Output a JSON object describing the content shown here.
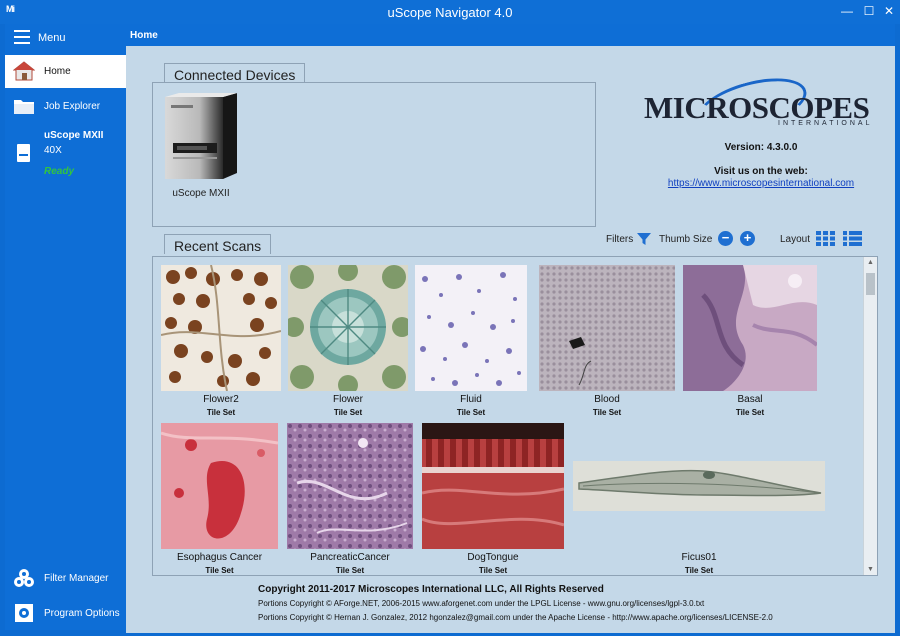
{
  "window": {
    "app_icon_text": "Mi",
    "title": "uScope Navigator 4.0",
    "minimize_glyph": "—",
    "maximize_glyph": "☐",
    "close_glyph": "✕"
  },
  "sidebar": {
    "menu_label": "Menu",
    "items": [
      {
        "label": "Home",
        "icon": "home-icon",
        "active": true
      },
      {
        "label": "Job Explorer",
        "icon": "folder-icon",
        "active": false
      }
    ],
    "device": {
      "name": "uScope MXII",
      "magnification": "40X",
      "status": "Ready",
      "icon": "scanner-icon"
    },
    "bottom_items": [
      {
        "label": "Filter Manager",
        "icon": "filter-manager-icon"
      },
      {
        "label": "Program Options",
        "icon": "settings-icon"
      }
    ]
  },
  "breadcrumb": "Home",
  "connected_devices": {
    "title": "Connected Devices",
    "devices": [
      {
        "label": "uScope MXII"
      }
    ]
  },
  "brand": {
    "logo_word": "MICROSCOPES",
    "logo_sub": "INTERNATIONAL",
    "version": "Version: 4.3.0.0",
    "visit": "Visit us on the web:",
    "url": "https://www.microscopesinternational.com"
  },
  "recent_scans": {
    "title": "Recent Scans",
    "filters_label": "Filters",
    "thumb_size_label": "Thumb Size",
    "zoom_out_glyph": "−",
    "zoom_in_glyph": "+",
    "layout_label": "Layout",
    "scans": [
      {
        "name": "Flower2",
        "type": "Tile Set"
      },
      {
        "name": "Flower",
        "type": "Tile Set"
      },
      {
        "name": "Fluid",
        "type": "Tile Set"
      },
      {
        "name": "Blood",
        "type": "Tile Set"
      },
      {
        "name": "Basal",
        "type": "Tile Set"
      },
      {
        "name": "Esophagus Cancer",
        "type": "Tile Set"
      },
      {
        "name": "PancreaticCancer",
        "type": "Tile Set"
      },
      {
        "name": "DogTongue",
        "type": "Tile Set"
      },
      {
        "name": "Ficus01",
        "type": "Tile Set"
      }
    ]
  },
  "footer": {
    "copyright": "Copyright 2011-2017 Microscopes International LLC, All Rights Reserved",
    "portion1": "Portions Copyright © AForge.NET, 2006-2015 www.aforgenet.com   under the LPGL License - www.gnu.org/licenses/lgpl-3.0.txt",
    "portion2": "Portions Copyright © Hernan J. Gonzalez, 2012 hgonzalez@gmail.com   under the Apache License - http://www.apache.org/licenses/LICENSE-2.0"
  },
  "colors": {
    "accent": "#0e6ed6",
    "panel": "#c4d8e8",
    "ready": "#32c53f",
    "link": "#1040c0"
  }
}
